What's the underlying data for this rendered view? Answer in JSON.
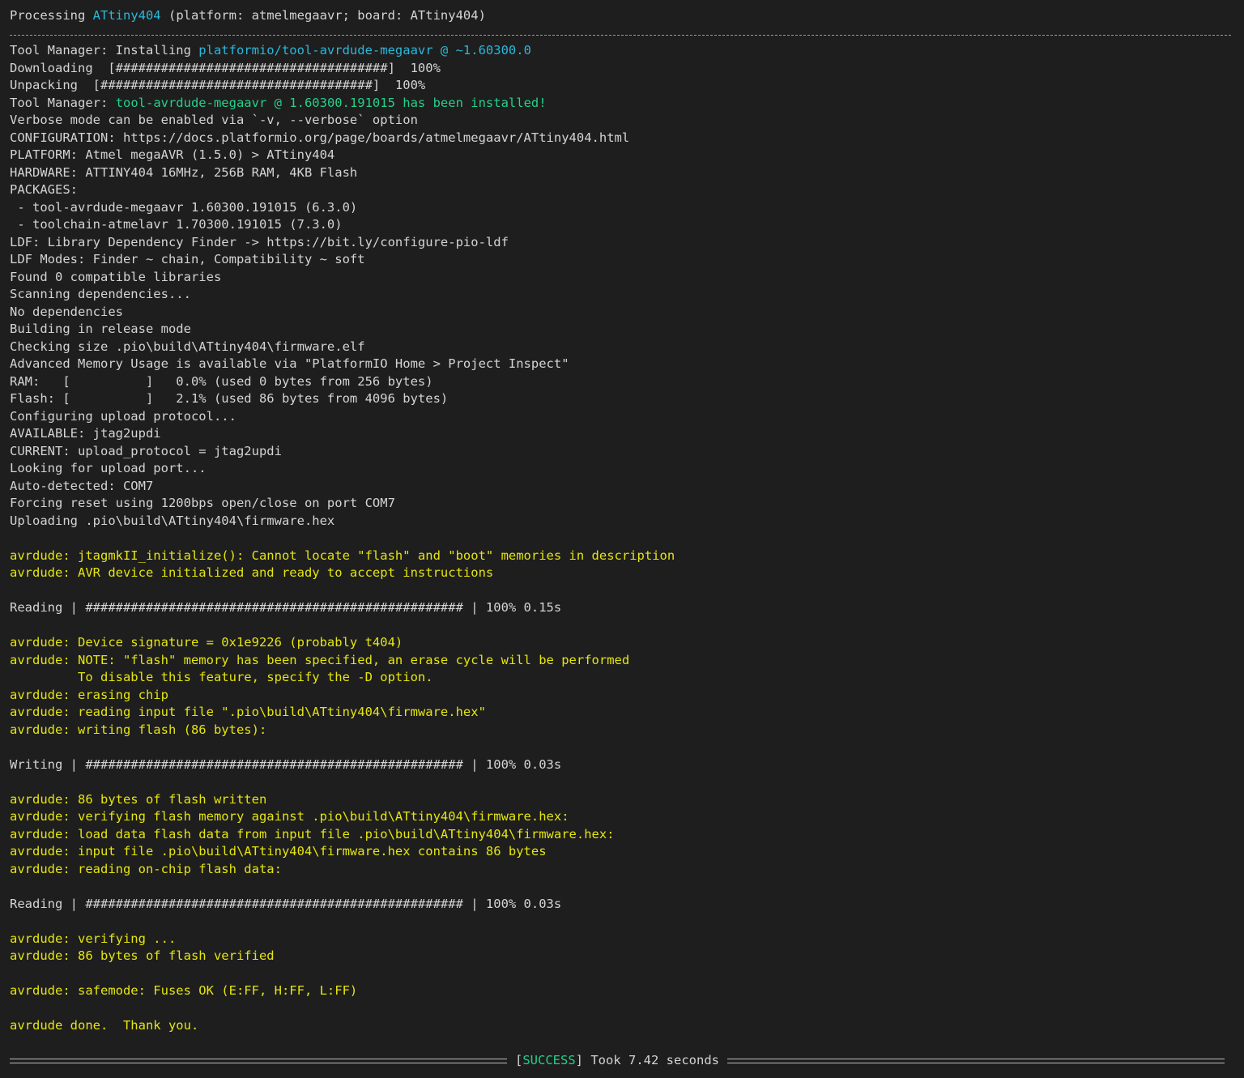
{
  "terminal": {
    "header": [
      {
        "text": "Processing ",
        "color": "plain"
      },
      {
        "text": "ATtiny404",
        "color": "cyan"
      },
      {
        "text": " (platform: atmelmegaavr; board: ATtiny404)",
        "color": "plain"
      }
    ],
    "lines": [
      [
        {
          "text": "Tool Manager: Installing ",
          "color": "plain"
        },
        {
          "text": "platformio/tool-avrdude-megaavr @ ~1.60300.0",
          "color": "cyan"
        }
      ],
      [
        {
          "text": "Downloading  [####################################]  100%",
          "color": "plain"
        }
      ],
      [
        {
          "text": "Unpacking  [####################################]  100%",
          "color": "plain"
        }
      ],
      [
        {
          "text": "Tool Manager: ",
          "color": "plain"
        },
        {
          "text": "tool-avrdude-megaavr @ 1.60300.191015 has been installed!",
          "color": "green"
        }
      ],
      [
        {
          "text": "Verbose mode can be enabled via `-v, --verbose` option",
          "color": "plain"
        }
      ],
      [
        {
          "text": "CONFIGURATION: https://docs.platformio.org/page/boards/atmelmegaavr/ATtiny404.html",
          "color": "plain"
        }
      ],
      [
        {
          "text": "PLATFORM: Atmel megaAVR (1.5.0) > ATtiny404",
          "color": "plain"
        }
      ],
      [
        {
          "text": "HARDWARE: ATTINY404 16MHz, 256B RAM, 4KB Flash",
          "color": "plain"
        }
      ],
      [
        {
          "text": "PACKAGES:",
          "color": "plain"
        }
      ],
      [
        {
          "text": " - tool-avrdude-megaavr 1.60300.191015 (6.3.0)",
          "color": "plain"
        }
      ],
      [
        {
          "text": " - toolchain-atmelavr 1.70300.191015 (7.3.0)",
          "color": "plain"
        }
      ],
      [
        {
          "text": "LDF: Library Dependency Finder -> https://bit.ly/configure-pio-ldf",
          "color": "plain"
        }
      ],
      [
        {
          "text": "LDF Modes: Finder ~ chain, Compatibility ~ soft",
          "color": "plain"
        }
      ],
      [
        {
          "text": "Found 0 compatible libraries",
          "color": "plain"
        }
      ],
      [
        {
          "text": "Scanning dependencies...",
          "color": "plain"
        }
      ],
      [
        {
          "text": "No dependencies",
          "color": "plain"
        }
      ],
      [
        {
          "text": "Building in release mode",
          "color": "plain"
        }
      ],
      [
        {
          "text": "Checking size .pio\\build\\ATtiny404\\firmware.elf",
          "color": "plain"
        }
      ],
      [
        {
          "text": "Advanced Memory Usage is available via \"PlatformIO Home > Project Inspect\"",
          "color": "plain"
        }
      ],
      [
        {
          "text": "RAM:   [          ]   0.0% (used 0 bytes from 256 bytes)",
          "color": "plain"
        }
      ],
      [
        {
          "text": "Flash: [          ]   2.1% (used 86 bytes from 4096 bytes)",
          "color": "plain"
        }
      ],
      [
        {
          "text": "Configuring upload protocol...",
          "color": "plain"
        }
      ],
      [
        {
          "text": "AVAILABLE: jtag2updi",
          "color": "plain"
        }
      ],
      [
        {
          "text": "CURRENT: upload_protocol = jtag2updi",
          "color": "plain"
        }
      ],
      [
        {
          "text": "Looking for upload port...",
          "color": "plain"
        }
      ],
      [
        {
          "text": "Auto-detected: COM7",
          "color": "plain"
        }
      ],
      [
        {
          "text": "Forcing reset using 1200bps open/close on port COM7",
          "color": "plain"
        }
      ],
      [
        {
          "text": "Uploading .pio\\build\\ATtiny404\\firmware.hex",
          "color": "plain"
        }
      ],
      [],
      [
        {
          "text": "avrdude: jtagmkII_initialize(): Cannot locate \"flash\" and \"boot\" memories in description",
          "color": "yellow"
        }
      ],
      [
        {
          "text": "avrdude: AVR device initialized and ready to accept instructions",
          "color": "yellow"
        }
      ],
      [],
      [
        {
          "text": "Reading | ################################################## | 100% 0.15s",
          "color": "plain"
        }
      ],
      [],
      [
        {
          "text": "avrdude: Device signature = 0x1e9226 (probably t404)",
          "color": "yellow"
        }
      ],
      [
        {
          "text": "avrdude: NOTE: \"flash\" memory has been specified, an erase cycle will be performed",
          "color": "yellow"
        }
      ],
      [
        {
          "text": "         To disable this feature, specify the -D option.",
          "color": "yellow"
        }
      ],
      [
        {
          "text": "avrdude: erasing chip",
          "color": "yellow"
        }
      ],
      [
        {
          "text": "avrdude: reading input file \".pio\\build\\ATtiny404\\firmware.hex\"",
          "color": "yellow"
        }
      ],
      [
        {
          "text": "avrdude: writing flash (86 bytes):",
          "color": "yellow"
        }
      ],
      [],
      [
        {
          "text": "Writing | ################################################## | 100% 0.03s",
          "color": "plain"
        }
      ],
      [],
      [
        {
          "text": "avrdude: 86 bytes of flash written",
          "color": "yellow"
        }
      ],
      [
        {
          "text": "avrdude: verifying flash memory against .pio\\build\\ATtiny404\\firmware.hex:",
          "color": "yellow"
        }
      ],
      [
        {
          "text": "avrdude: load data flash data from input file .pio\\build\\ATtiny404\\firmware.hex:",
          "color": "yellow"
        }
      ],
      [
        {
          "text": "avrdude: input file .pio\\build\\ATtiny404\\firmware.hex contains 86 bytes",
          "color": "yellow"
        }
      ],
      [
        {
          "text": "avrdude: reading on-chip flash data:",
          "color": "yellow"
        }
      ],
      [],
      [
        {
          "text": "Reading | ################################################## | 100% 0.03s",
          "color": "plain"
        }
      ],
      [],
      [
        {
          "text": "avrdude: verifying ...",
          "color": "yellow"
        }
      ],
      [
        {
          "text": "avrdude: 86 bytes of flash verified",
          "color": "yellow"
        }
      ],
      [],
      [
        {
          "text": "avrdude: safemode: Fuses OK (E:FF, H:FF, L:FF)",
          "color": "yellow"
        }
      ],
      [],
      [
        {
          "text": "avrdude done.  Thank you.",
          "color": "yellow"
        }
      ],
      []
    ],
    "final": {
      "open_bracket": "[",
      "status": "SUCCESS",
      "close_bracket": "]",
      "took_text": " Took 7.42 seconds"
    },
    "colors": {
      "background": "#1e1e1e",
      "plain": "#d4d4d4",
      "cyan": "#29b8db",
      "green": "#23d18b",
      "yellow": "#e5e510"
    }
  }
}
